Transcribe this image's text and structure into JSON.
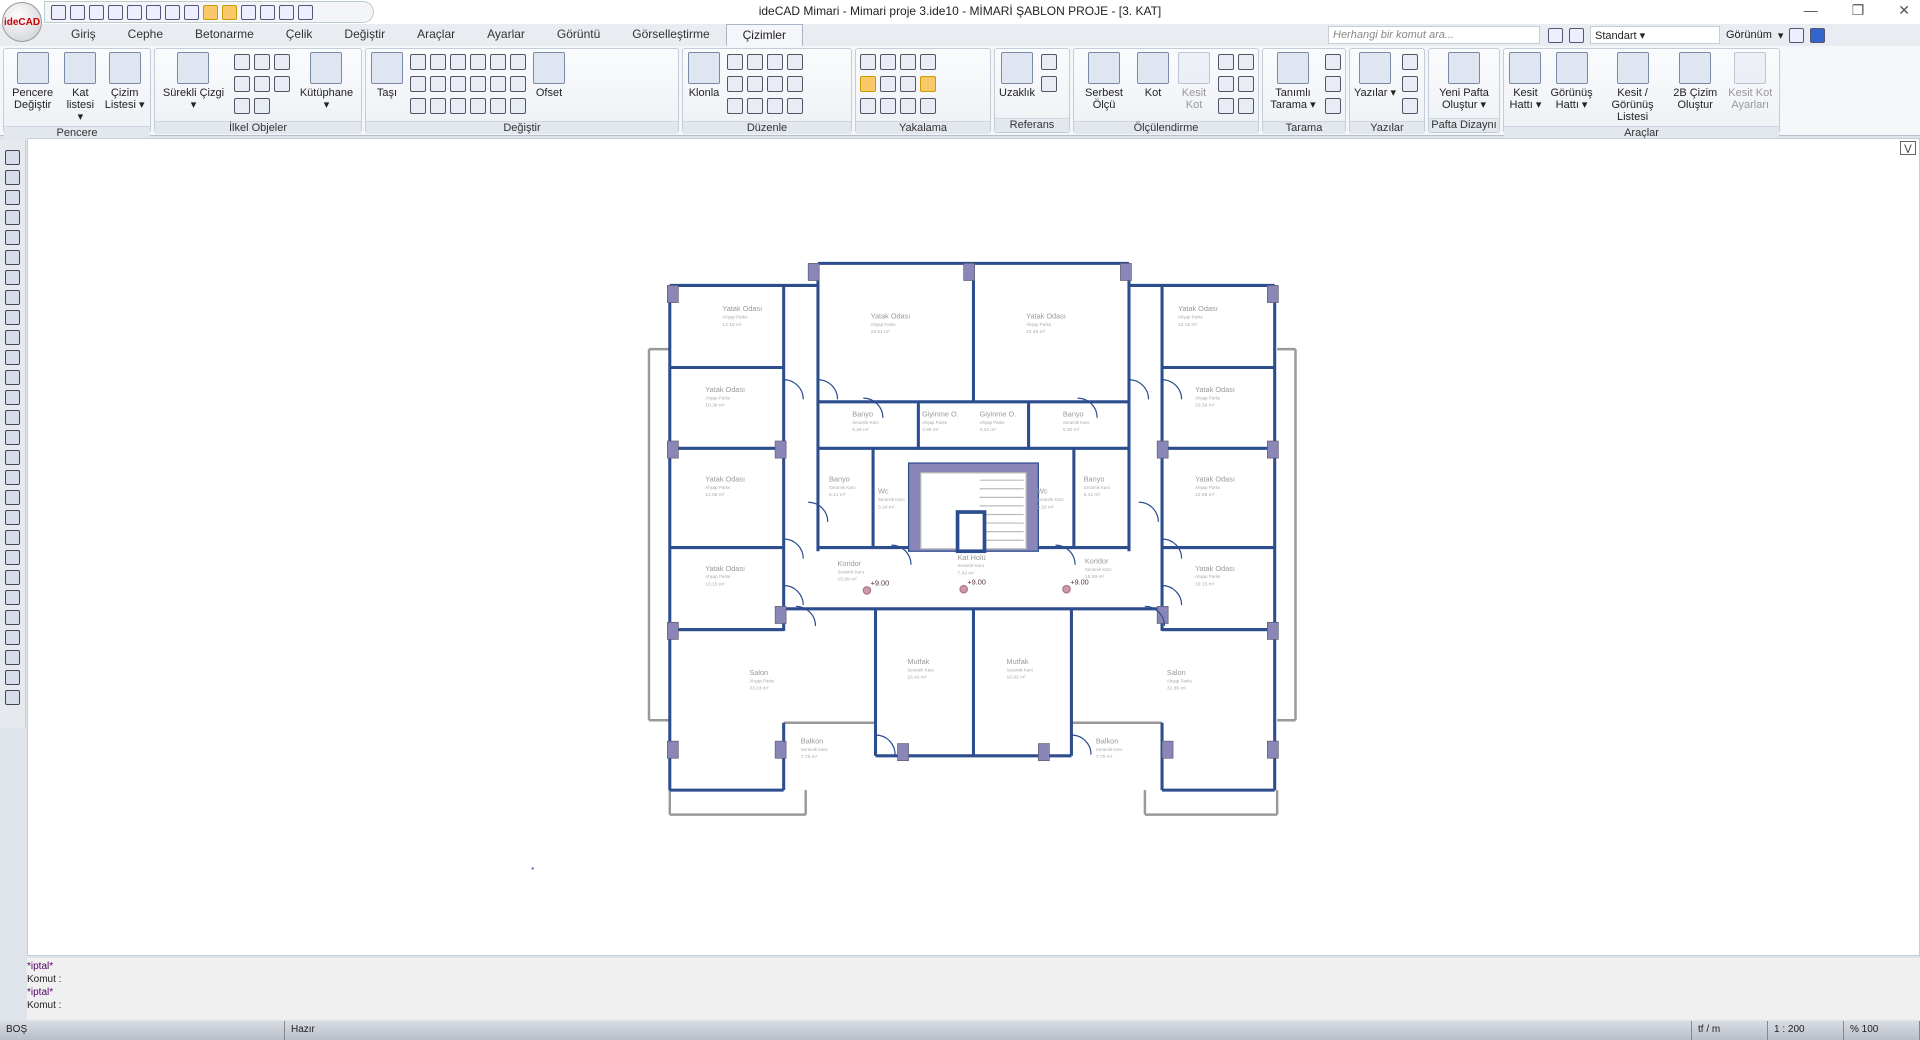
{
  "app": {
    "logo": "ideCAD",
    "title": "ideCAD Mimari - Mimari proje 3.ide10 - MİMARİ ŞABLON PROJE - [3. KAT]",
    "window_controls": [
      "—",
      "❐",
      "✕"
    ]
  },
  "tabs": [
    "Giriş",
    "Cephe",
    "Betonarme",
    "Çelik",
    "Değiştir",
    "Araçlar",
    "Ayarlar",
    "Görüntü",
    "Görselleştirme",
    "Çizimler"
  ],
  "active_tab": "Çizimler",
  "search": {
    "placeholder": "Herhangi bir komut ara..."
  },
  "style_select": "Standart",
  "view_menu": "Görünüm",
  "ribbon": [
    {
      "label": "Pencere",
      "big": [
        "Pencere Değiştir",
        "Kat listesi ▾",
        "Çizim Listesi ▾"
      ],
      "small": 0
    },
    {
      "label": "İlkel Objeler",
      "big": [
        "Sürekli Çizgi ▾"
      ],
      "small": 8,
      "big2": [
        "Kütüphane ▾"
      ]
    },
    {
      "label": "Değiştir",
      "big": [
        "Taşı"
      ],
      "small": 18,
      "big2": [
        "Ofset"
      ]
    },
    {
      "label": "Düzenle",
      "big": [
        "Klonla"
      ],
      "small": 12
    },
    {
      "label": "Yakalama",
      "big": [],
      "small": 12
    },
    {
      "label": "Referans",
      "big": [
        "Uzaklık"
      ],
      "small": 2
    },
    {
      "label": "Ölçülendirme",
      "big": [
        "Serbest Ölçü",
        "Kot",
        "Kesit Kot"
      ],
      "small": 6
    },
    {
      "label": "Tarama",
      "big": [
        "Tanımlı Tarama ▾"
      ],
      "small": 3
    },
    {
      "label": "Yazılar",
      "big": [
        "Yazılar ▾"
      ],
      "small": 3
    },
    {
      "label": "Pafta Dizaynı",
      "big": [
        "Yeni Pafta Oluştur ▾"
      ],
      "small": 0
    },
    {
      "label": "Araçlar",
      "big": [
        "Kesit Hattı ▾",
        "Görünüş Hattı ▾",
        "Kesit / Görünüş Listesi",
        "2B Çizim Oluştur",
        "Kesit Kot Ayarları"
      ],
      "small": 0
    }
  ],
  "rooms": [
    {
      "name": "Yatak Odası",
      "floor": "Ahşap Parke",
      "area": "13.15 m²"
    },
    {
      "name": "Yatak Odası",
      "floor": "Ahşap Parke",
      "area": "23.51 m²"
    },
    {
      "name": "Yatak Odası",
      "floor": "Ahşap Parke",
      "area": "24.49 m²"
    },
    {
      "name": "Yatak Odası",
      "floor": "Ahşap Parke",
      "area": "13.15 m²"
    },
    {
      "name": "Yatak Odası",
      "floor": "Ahşap Parke",
      "area": "10.39 m²"
    },
    {
      "name": "Yatak Odası",
      "floor": "Ahşap Parke",
      "area": "10.39 m²"
    },
    {
      "name": "Banyo",
      "floor": "Seramik Karo",
      "area": "5.26 m²"
    },
    {
      "name": "Banyo",
      "floor": "Seramik Karo",
      "area": "5.30 m²"
    },
    {
      "name": "Giyinme O.",
      "floor": "Ahşap Parke",
      "area": "3.88 m²"
    },
    {
      "name": "Giyinme O.",
      "floor": "Ahşap Parke",
      "area": "4.34 m²"
    },
    {
      "name": "Yatak Odası",
      "floor": "Ahşap Parke",
      "area": "12.88 m²"
    },
    {
      "name": "Yatak Odası",
      "floor": "Ahşap Parke",
      "area": "12.88 m²"
    },
    {
      "name": "Banyo",
      "floor": "Seramik Karo",
      "area": "6.41 m²"
    },
    {
      "name": "Banyo",
      "floor": "Seramik Karo",
      "area": "6.41 m²"
    },
    {
      "name": "Wc",
      "floor": "Seramik Karo",
      "area": "3.18 m²"
    },
    {
      "name": "Wc",
      "floor": "Seramik Karo",
      "area": "3.18 m²"
    },
    {
      "name": "Koridor",
      "floor": "Seramik Karo",
      "area": "15.69 m²"
    },
    {
      "name": "Koridor",
      "floor": "Seramik Karo",
      "area": "15.69 m²"
    },
    {
      "name": "Kat Holü",
      "floor": "Seramik Karo",
      "area": "7.42 m²"
    },
    {
      "name": "Yatak Odası",
      "floor": "Ahşap Parke",
      "area": "10.15 m²"
    },
    {
      "name": "Yatak Odası",
      "floor": "Ahşap Parke",
      "area": "10.15 m²"
    },
    {
      "name": "Salon",
      "floor": "Ahşap Parke",
      "area": "33.24 m²"
    },
    {
      "name": "Salon",
      "floor": "Ahşap Parke",
      "area": "32.85 m²"
    },
    {
      "name": "Mutfak",
      "floor": "Seramik Karo",
      "area": "16.42 m²"
    },
    {
      "name": "Mutfak",
      "floor": "Seramik Karo",
      "area": "16.92 m²"
    },
    {
      "name": "Balkon",
      "floor": "Seramik Karo",
      "area": "7.75 m²"
    },
    {
      "name": "Balkon",
      "floor": "Seramik Karo",
      "area": "7.70 m²"
    }
  ],
  "levels": [
    "+9.00",
    "+9.00",
    "+9.00"
  ],
  "command_log": [
    "*iptal*",
    "Komut :",
    "*iptal*",
    "Komut :"
  ],
  "status": {
    "mode": "BOŞ",
    "state": "Hazır",
    "units": "tf / m",
    "scale": "1 : 200",
    "zoom": "% 100"
  }
}
